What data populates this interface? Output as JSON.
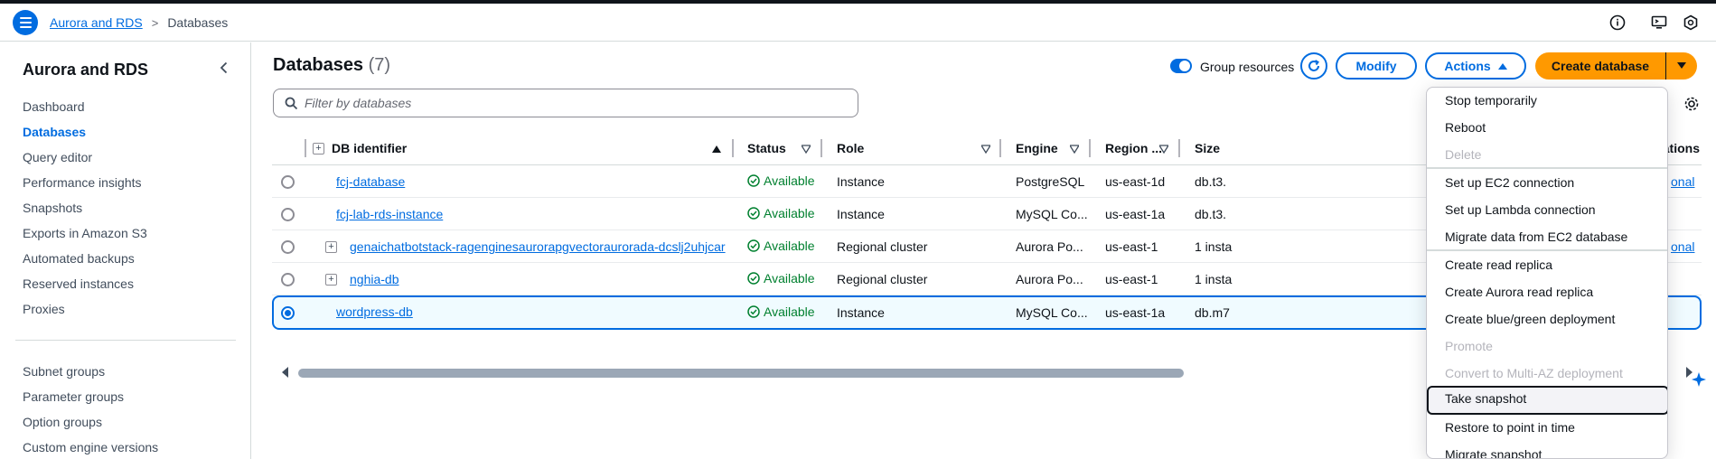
{
  "header": {
    "breadcrumb_service": "Aurora and RDS",
    "breadcrumb_sep": ">",
    "breadcrumb_current": "Databases"
  },
  "sidebar": {
    "title": "Aurora and RDS",
    "items": [
      {
        "label": "Dashboard"
      },
      {
        "label": "Databases"
      },
      {
        "label": "Query editor"
      },
      {
        "label": "Performance insights"
      },
      {
        "label": "Snapshots"
      },
      {
        "label": "Exports in Amazon S3"
      },
      {
        "label": "Automated backups"
      },
      {
        "label": "Reserved instances"
      },
      {
        "label": "Proxies"
      }
    ],
    "items2": [
      {
        "label": "Subnet groups"
      },
      {
        "label": "Parameter groups"
      },
      {
        "label": "Option groups"
      },
      {
        "label": "Custom engine versions"
      }
    ]
  },
  "main": {
    "title": "Databases",
    "count": "(7)",
    "group_resources_label": "Group resources",
    "modify_label": "Modify",
    "actions_label": "Actions",
    "create_label": "Create database",
    "filter_placeholder": "Filter by databases"
  },
  "table": {
    "columns": [
      "DB identifier",
      "Status",
      "Role",
      "Engine",
      "Region ...",
      "Size",
      "ations"
    ],
    "rows": [
      {
        "id": "fcj-database",
        "status": "Available",
        "role": "Instance",
        "engine": "PostgreSQL",
        "region": "us-east-1d",
        "size": "db.t3.",
        "extra": "onal"
      },
      {
        "id": "fcj-lab-rds-instance",
        "status": "Available",
        "role": "Instance",
        "engine": "MySQL Co...",
        "region": "us-east-1a",
        "size": "db.t3.",
        "extra": ""
      },
      {
        "id": "genaichatbotstack-ragenginesaurorapgvectoraurorada-dcslj2uhjcar",
        "status": "Available",
        "role": "Regional cluster",
        "engine": "Aurora Po...",
        "region": "us-east-1",
        "size": "1 insta",
        "extra": "onal"
      },
      {
        "id": "nghia-db",
        "status": "Available",
        "role": "Regional cluster",
        "engine": "Aurora Po...",
        "region": "us-east-1",
        "size": "1 insta",
        "extra": ""
      },
      {
        "id": "wordpress-db",
        "status": "Available",
        "role": "Instance",
        "engine": "MySQL Co...",
        "region": "us-east-1a",
        "size": "db.m7",
        "extra": ""
      }
    ]
  },
  "actions_menu": {
    "items": [
      {
        "label": "Stop temporarily"
      },
      {
        "label": "Reboot"
      },
      {
        "label": "Delete"
      },
      {
        "label": "Set up EC2 connection"
      },
      {
        "label": "Set up Lambda connection"
      },
      {
        "label": "Migrate data from EC2 database"
      },
      {
        "label": "Create read replica"
      },
      {
        "label": "Create Aurora read replica"
      },
      {
        "label": "Create blue/green deployment"
      },
      {
        "label": "Promote"
      },
      {
        "label": "Convert to Multi-AZ deployment"
      },
      {
        "label": "Take snapshot"
      },
      {
        "label": "Restore to point in time"
      },
      {
        "label": "Migrate snapshot"
      }
    ]
  },
  "colors": {
    "accent": "#006ce0",
    "primary_button": "#ff9900",
    "success": "#00802f",
    "disabled": "#b4b4bb"
  },
  "icons": {
    "menu": "hamburger-icon",
    "info": "info-icon",
    "cloudshell": "cloudshell-icon",
    "notifications": "hexagon-icon",
    "refresh": "refresh-icon",
    "search": "search-icon",
    "settings": "gear-icon",
    "status": "check-circle-icon"
  }
}
